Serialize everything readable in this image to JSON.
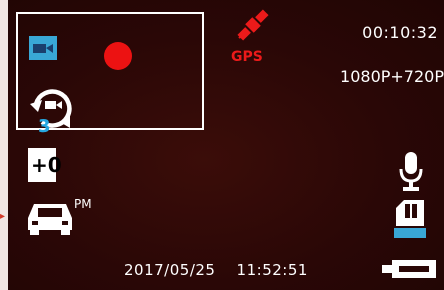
{
  "status": {
    "recording_time": "00:10:32",
    "resolution": "1080P+720P",
    "gps_label": "GPS",
    "date": "2017/05/25",
    "time": "11:52:51"
  },
  "settings": {
    "loop_recording_minutes": "3",
    "exposure_value": "+0",
    "parking_mode_label": "PM"
  },
  "icons": {
    "mode": "video-camera-icon",
    "recording": "record-dot-icon",
    "loop": "loop-recording-icon",
    "gps": "gps-satellite-icon",
    "exposure": "exposure-icon",
    "parking": "car-icon",
    "audio": "microphone-icon",
    "storage": "sd-card-icon",
    "power": "battery-icon"
  },
  "colors": {
    "background": "#2a0706",
    "accent_blue": "#39a7d6",
    "record_red": "#ec1212",
    "gps_red": "#ec1a1a",
    "foreground": "#ffffff"
  }
}
